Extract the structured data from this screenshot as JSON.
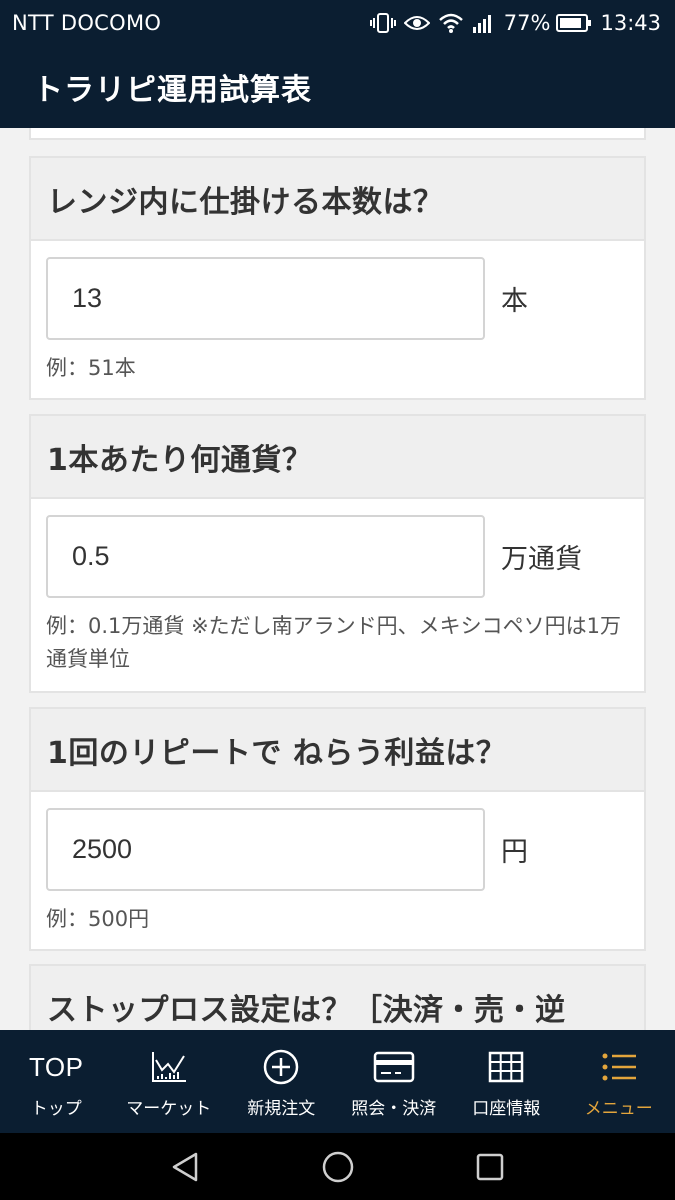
{
  "status_bar": {
    "carrier": "NTT DOCOMO",
    "battery": "77%",
    "time": "13:43"
  },
  "header": {
    "title": "トラリピ運用試算表"
  },
  "cards": [
    {
      "question": "レンジ内に仕掛ける本数は？",
      "value": "13",
      "unit": "本",
      "hint": "例：51本"
    },
    {
      "question": "1本あたり何通貨？",
      "value": "0.5",
      "unit": "万通貨",
      "hint": "例：0.1万通貨 ※ただし南アランド円、メキシコペソ円は1万通貨単位"
    },
    {
      "question": "1回のリピートで ねらう利益は？",
      "value": "2500",
      "unit": "円",
      "hint": "例：500円"
    },
    {
      "question": "ストップロス設定は？［決済・売・逆"
    }
  ],
  "bottom_nav": {
    "items": [
      {
        "icon_text": "TOP",
        "label": "トップ"
      },
      {
        "icon": "chart-icon",
        "label": "マーケット"
      },
      {
        "icon": "plus-circle-icon",
        "label": "新規注文"
      },
      {
        "icon": "card-icon",
        "label": "照会・決済"
      },
      {
        "icon": "grid-icon",
        "label": "口座情報"
      },
      {
        "icon": "menu-list-icon",
        "label": "メニュー"
      }
    ],
    "active_color": "#e3a53c"
  },
  "colors": {
    "primary_dark": "#0b1e31",
    "accent": "#e3a53c"
  }
}
